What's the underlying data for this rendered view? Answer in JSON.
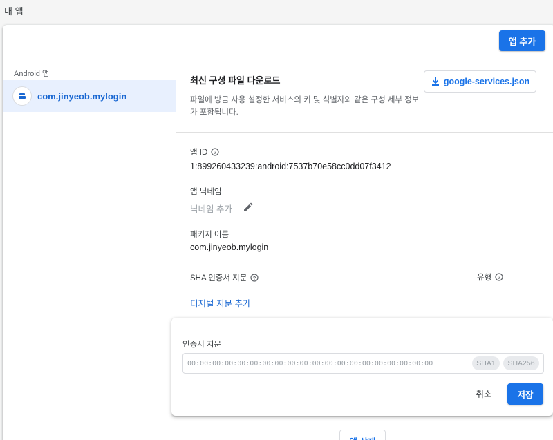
{
  "page": {
    "title": "내 앱"
  },
  "header": {
    "add_app_label": "앱 추가"
  },
  "sidebar": {
    "section_label": "Android 앱",
    "items": [
      {
        "label": "com.jinyeob.mylogin",
        "icon": "android-app-icon",
        "selected": true
      }
    ]
  },
  "config_download": {
    "title": "최신 구성 파일 다운로드",
    "description": "파일에 방금 사용 설정한 서비스의 키 및 식별자와 같은 구성 세부 정보가 포함됩니다.",
    "button_label": "google-services.json"
  },
  "app_info": {
    "app_id_label": "앱 ID",
    "app_id_value": "1:899260433239:android:7537b70e58cc0dd07f3412",
    "nickname_label": "앱 닉네임",
    "nickname_placeholder": "닉네임 추가",
    "package_label": "패키지 이름",
    "package_value": "com.jinyeob.mylogin"
  },
  "sha": {
    "fingerprint_header": "SHA 인증서 지문",
    "type_header": "유형",
    "add_link": "디지털 지문 추가"
  },
  "fingerprint_dialog": {
    "field_label": "인증서 지문",
    "placeholder": "00:00:00:00:00:00:00:00:00:00:00:00:00:00:00:00:00:00:00:00",
    "chip_sha1": "SHA1",
    "chip_sha256": "SHA256",
    "cancel_label": "취소",
    "save_label": "저장"
  },
  "footer": {
    "delete_app_label": "앱 삭제"
  },
  "colors": {
    "accent": "#1a73e8",
    "selected_bg": "#e8f0fe",
    "link": "#1967d2"
  }
}
